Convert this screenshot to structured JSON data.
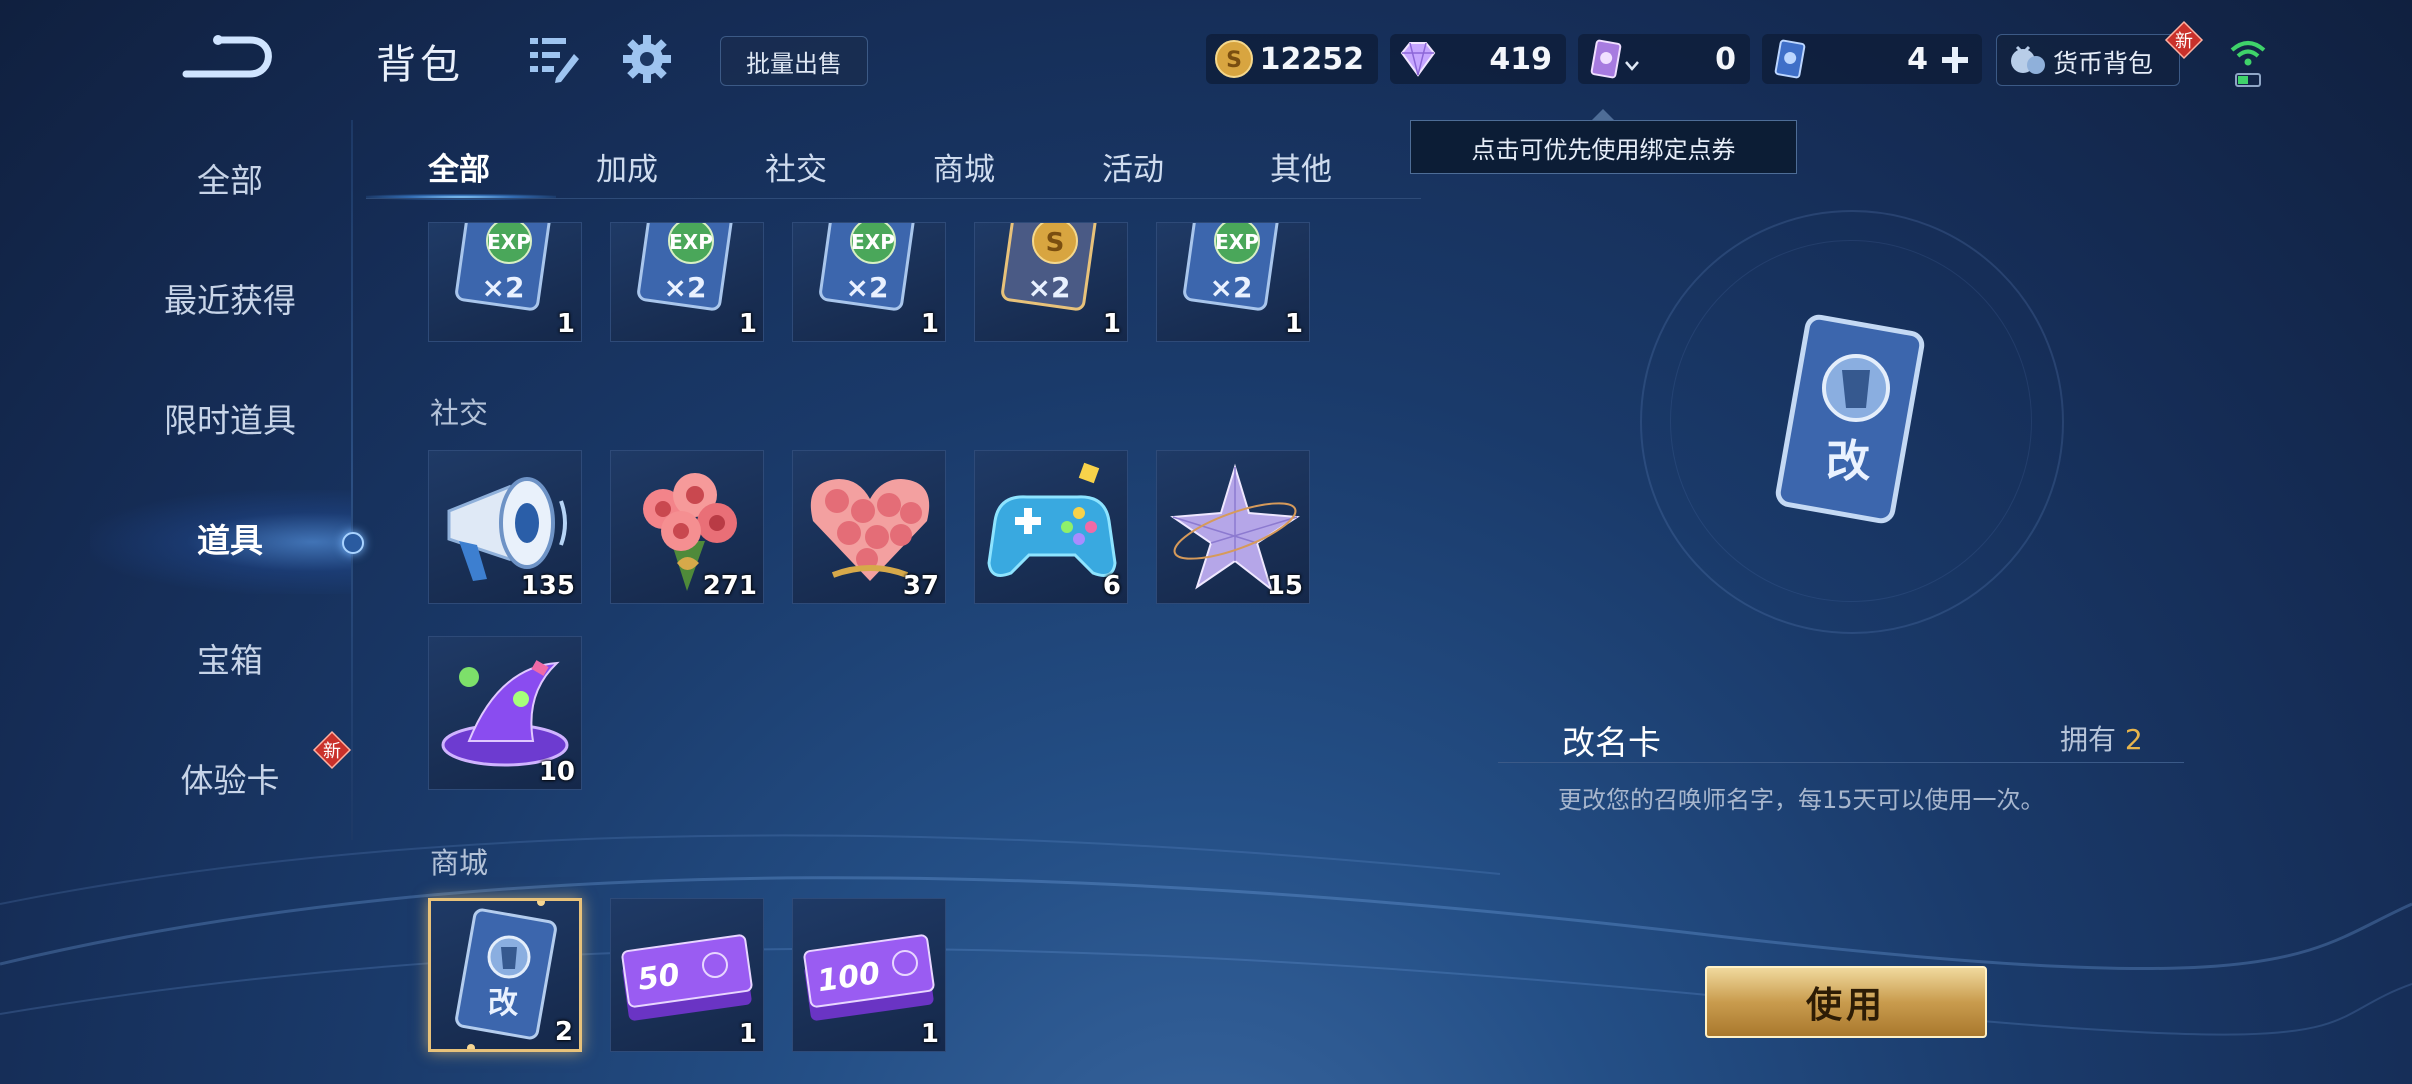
{
  "header": {
    "title": "背包",
    "bulk_sell": "批量出售",
    "currencies": {
      "gold": "12252",
      "diamond": "419",
      "bound_voucher": "0",
      "voucher": "4"
    },
    "wallet_label": "货币背包",
    "new_badge": "新",
    "tooltip": "点击可优先使用绑定点券"
  },
  "sidebar": {
    "items": [
      {
        "label": "全部"
      },
      {
        "label": "最近获得"
      },
      {
        "label": "限时道具"
      },
      {
        "label": "道具"
      },
      {
        "label": "宝箱"
      },
      {
        "label": "体验卡"
      }
    ],
    "active": "道具",
    "new_badge": "新"
  },
  "tabs": {
    "items": [
      {
        "label": "全部"
      },
      {
        "label": "加成"
      },
      {
        "label": "社交"
      },
      {
        "label": "商城"
      },
      {
        "label": "活动"
      },
      {
        "label": "其他"
      }
    ],
    "active": "全部"
  },
  "sections": {
    "boost": {
      "items": [
        {
          "icon": "exp-x2-card-icon",
          "count": "1"
        },
        {
          "icon": "exp-x2-card-icon",
          "count": "1"
        },
        {
          "icon": "exp-x2-card-icon",
          "count": "1"
        },
        {
          "icon": "gold-x2-card-icon",
          "count": "1"
        },
        {
          "icon": "exp-x2-card-icon",
          "count": "1"
        }
      ],
      "exp_text": "EXP",
      "x2_text": "×2"
    },
    "social": {
      "title": "社交",
      "items": [
        {
          "icon": "megaphone-icon",
          "count": "135"
        },
        {
          "icon": "rose-bouquet-icon",
          "count": "271"
        },
        {
          "icon": "rose-heart-icon",
          "count": "37"
        },
        {
          "icon": "gamepad-icon",
          "count": "6"
        },
        {
          "icon": "crystal-star-icon",
          "count": "15"
        },
        {
          "icon": "purple-hat-icon",
          "count": "10"
        }
      ]
    },
    "shop": {
      "title": "商城",
      "items": [
        {
          "icon": "rename-card-icon",
          "count": "2",
          "text": "改"
        },
        {
          "icon": "voucher-50-icon",
          "count": "1",
          "text": "50"
        },
        {
          "icon": "voucher-100-icon",
          "count": "1",
          "text": "100"
        }
      ]
    }
  },
  "detail": {
    "name": "改名卡",
    "own_label": "拥有",
    "own_count": "2",
    "description": "更改您的召唤师名字，每15天可以使用一次。",
    "card_text": "改",
    "use_button": "使用"
  },
  "colors": {
    "accent_gold": "#e8b54c",
    "button_gold": "#c99c4e",
    "background": "#1a3a6a"
  }
}
